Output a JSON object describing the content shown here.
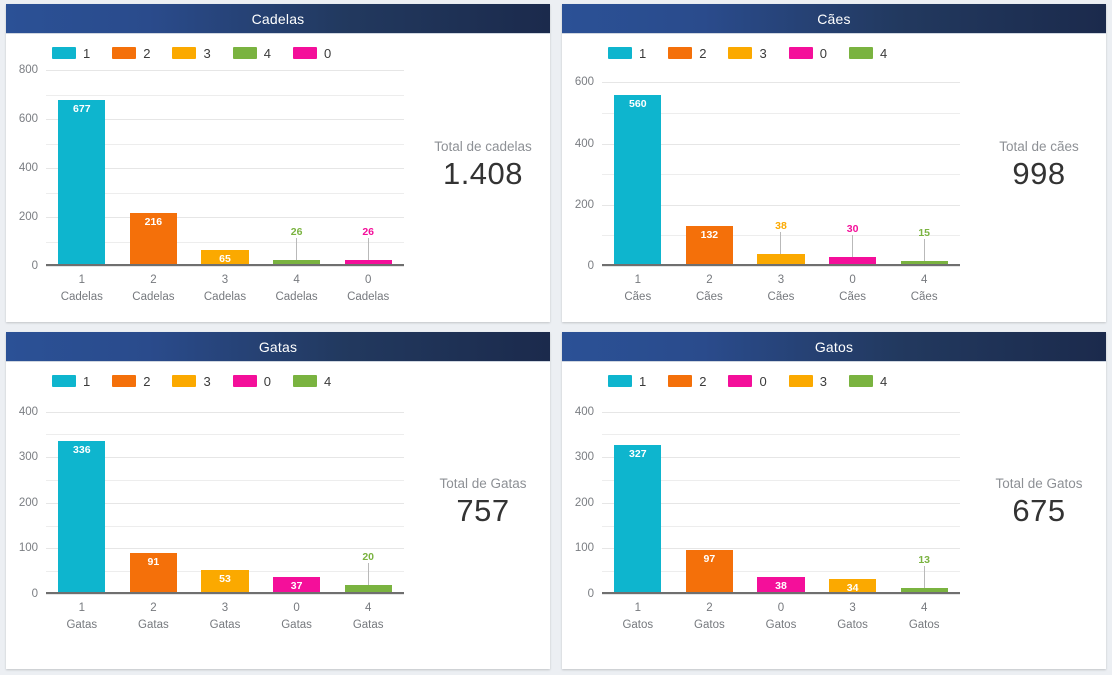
{
  "theme": {
    "header_gradient_start": "#2b5196",
    "header_gradient_end": "#1b2a4c",
    "page_background": "#eceff3",
    "panel_background": "#ffffff",
    "axis_color": "#6f6f6f",
    "gridline_color": "#ededed",
    "total_label_color": "#8d9095",
    "total_value_color": "#333333"
  },
  "series_colors": {
    "cyan": "#0eb5ce",
    "orange": "#f4700a",
    "amber": "#fba900",
    "green": "#7ab340",
    "magenta": "#f40f9a"
  },
  "panels": [
    {
      "id": "cadelas",
      "title": "Cadelas",
      "total_label": "Total de cadelas",
      "total_value": "1.408",
      "legend": [
        {
          "label": "1",
          "color": "#0eb5ce"
        },
        {
          "label": "2",
          "color": "#f4700a"
        },
        {
          "label": "3",
          "color": "#fba900"
        },
        {
          "label": "4",
          "color": "#7ab340"
        },
        {
          "label": "0",
          "color": "#f40f9a"
        }
      ],
      "chart_data": {
        "type": "bar",
        "title": "Cadelas",
        "xlabel": "",
        "ylabel": "",
        "ylim": [
          0,
          800
        ],
        "y_ticks": [
          0,
          200,
          400,
          600,
          800
        ],
        "y_minor_step": 100,
        "grid": true,
        "legend_position": "top-left",
        "categories": [
          "1",
          "2",
          "3",
          "4",
          "0"
        ],
        "category_sublabels": [
          "Cadelas",
          "Cadelas",
          "Cadelas",
          "Cadelas",
          "Cadelas"
        ],
        "values": [
          677,
          216,
          65,
          26,
          26
        ],
        "value_labels": [
          "677",
          "216",
          "65",
          "26",
          "26"
        ],
        "colors": [
          "#0eb5ce",
          "#f4700a",
          "#fba900",
          "#7ab340",
          "#f40f9a"
        ],
        "label_placement": [
          "inside",
          "inside",
          "inside",
          "outside",
          "outside"
        ]
      }
    },
    {
      "id": "caes",
      "title": "Cães",
      "total_label": "Total de cães",
      "total_value": "998",
      "legend": [
        {
          "label": "1",
          "color": "#0eb5ce"
        },
        {
          "label": "2",
          "color": "#f4700a"
        },
        {
          "label": "3",
          "color": "#fba900"
        },
        {
          "label": "0",
          "color": "#f40f9a"
        },
        {
          "label": "4",
          "color": "#7ab340"
        }
      ],
      "chart_data": {
        "type": "bar",
        "title": "Cães",
        "xlabel": "",
        "ylabel": "",
        "ylim": [
          0,
          640
        ],
        "y_ticks": [
          0,
          200,
          400,
          600
        ],
        "y_minor_step": 100,
        "grid": true,
        "legend_position": "top-left",
        "categories": [
          "1",
          "2",
          "3",
          "0",
          "4"
        ],
        "category_sublabels": [
          "Cães",
          "Cães",
          "Cães",
          "Cães",
          "Cães"
        ],
        "values": [
          560,
          132,
          38,
          30,
          15
        ],
        "value_labels": [
          "560",
          "132",
          "38",
          "30",
          "15"
        ],
        "colors": [
          "#0eb5ce",
          "#f4700a",
          "#fba900",
          "#f40f9a",
          "#7ab340"
        ],
        "label_placement": [
          "inside",
          "inside",
          "outside",
          "outside",
          "outside"
        ]
      }
    },
    {
      "id": "gatas",
      "title": "Gatas",
      "total_label": "Total de Gatas",
      "total_value": "757",
      "legend": [
        {
          "label": "1",
          "color": "#0eb5ce"
        },
        {
          "label": "2",
          "color": "#f4700a"
        },
        {
          "label": "3",
          "color": "#fba900"
        },
        {
          "label": "0",
          "color": "#f40f9a"
        },
        {
          "label": "4",
          "color": "#7ab340"
        }
      ],
      "chart_data": {
        "type": "bar",
        "title": "Gatas",
        "xlabel": "",
        "ylabel": "",
        "ylim": [
          0,
          430
        ],
        "y_ticks": [
          0,
          100,
          200,
          300,
          400
        ],
        "y_minor_step": 50,
        "grid": true,
        "legend_position": "top-left",
        "categories": [
          "1",
          "2",
          "3",
          "0",
          "4"
        ],
        "category_sublabels": [
          "Gatas",
          "Gatas",
          "Gatas",
          "Gatas",
          "Gatas"
        ],
        "values": [
          336,
          91,
          53,
          37,
          20
        ],
        "value_labels": [
          "336",
          "91",
          "53",
          "37",
          "20"
        ],
        "colors": [
          "#0eb5ce",
          "#f4700a",
          "#fba900",
          "#f40f9a",
          "#7ab340"
        ],
        "label_placement": [
          "inside",
          "inside",
          "inside",
          "inside",
          "outside"
        ]
      }
    },
    {
      "id": "gatos",
      "title": "Gatos",
      "total_label": "Total de Gatos",
      "total_value": "675",
      "legend": [
        {
          "label": "1",
          "color": "#0eb5ce"
        },
        {
          "label": "2",
          "color": "#f4700a"
        },
        {
          "label": "0",
          "color": "#f40f9a"
        },
        {
          "label": "3",
          "color": "#fba900"
        },
        {
          "label": "4",
          "color": "#7ab340"
        }
      ],
      "chart_data": {
        "type": "bar",
        "title": "Gatos",
        "xlabel": "",
        "ylabel": "",
        "ylim": [
          0,
          430
        ],
        "y_ticks": [
          0,
          100,
          200,
          300,
          400
        ],
        "y_minor_step": 50,
        "grid": true,
        "legend_position": "top-left",
        "categories": [
          "1",
          "2",
          "0",
          "3",
          "4"
        ],
        "category_sublabels": [
          "Gatos",
          "Gatos",
          "Gatos",
          "Gatos",
          "Gatos"
        ],
        "values": [
          327,
          97,
          38,
          34,
          13
        ],
        "value_labels": [
          "327",
          "97",
          "38",
          "34",
          "13"
        ],
        "colors": [
          "#0eb5ce",
          "#f4700a",
          "#f40f9a",
          "#fba900",
          "#7ab340"
        ],
        "label_placement": [
          "inside",
          "inside",
          "inside",
          "inside",
          "outside"
        ]
      }
    }
  ]
}
